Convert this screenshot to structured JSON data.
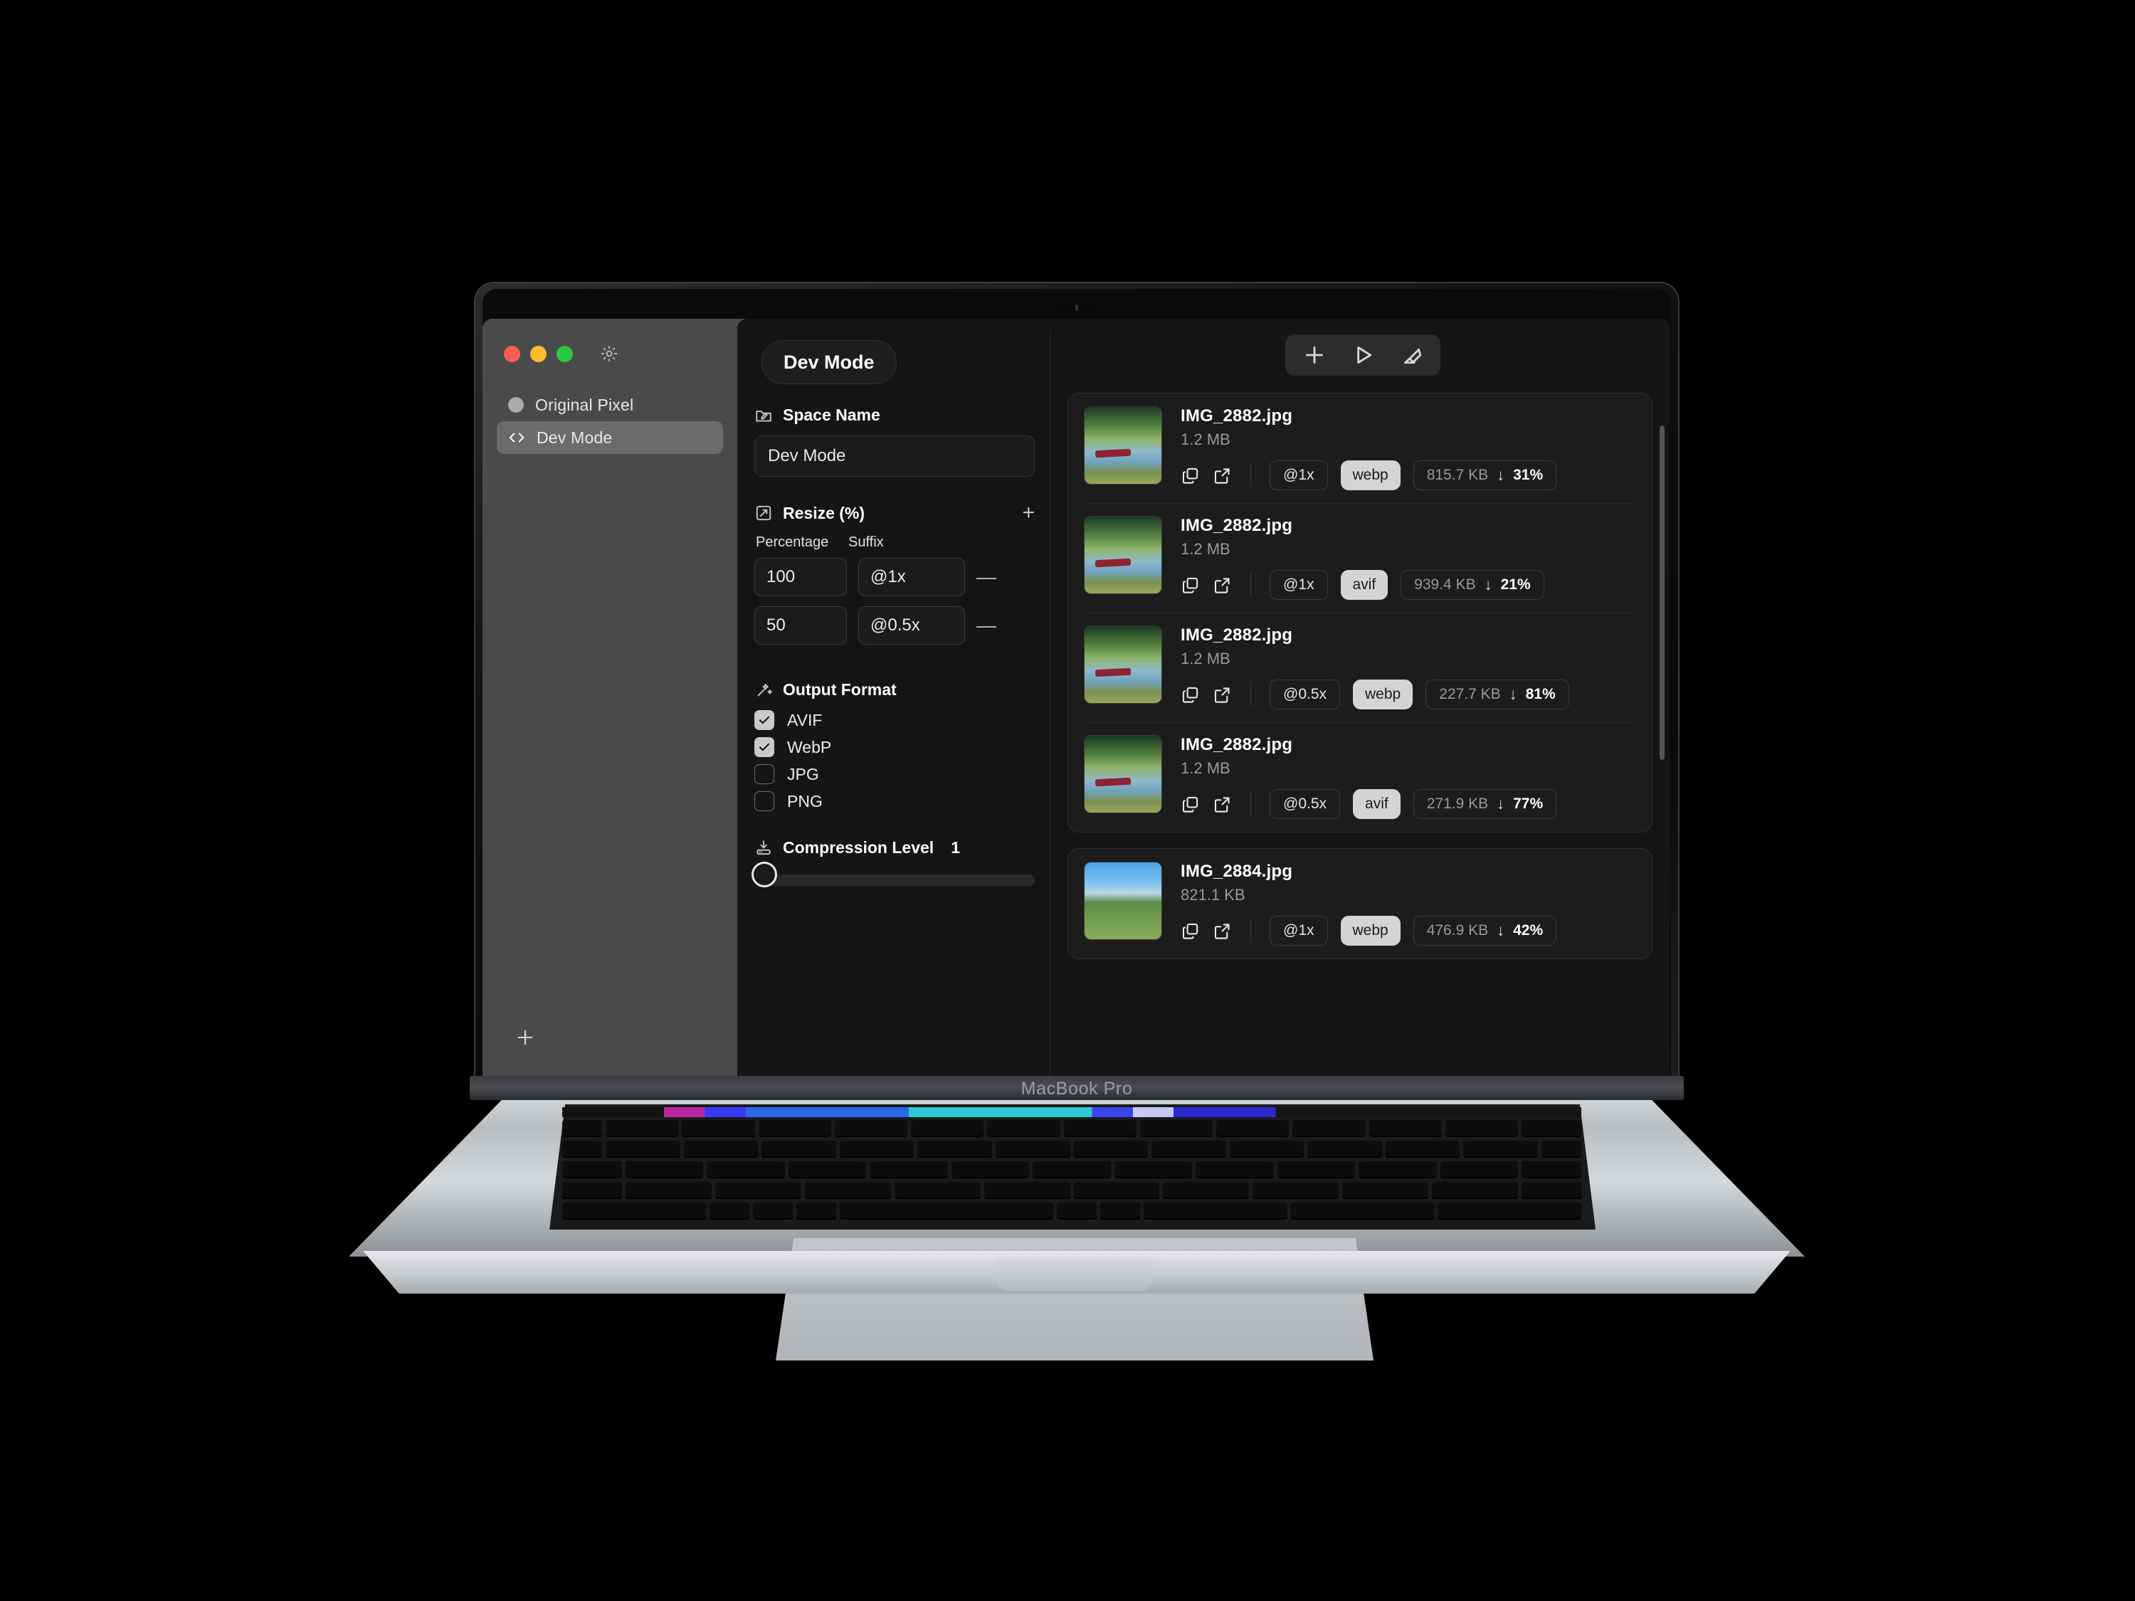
{
  "device": {
    "label": "MacBook Pro"
  },
  "window": {
    "traffic_lights": [
      "close",
      "minimize",
      "zoom"
    ],
    "gear_icon": "gear-icon"
  },
  "sidebar": {
    "items": [
      {
        "label": "Original Pixel",
        "icon": "dot-icon",
        "selected": false
      },
      {
        "label": "Dev Mode",
        "icon": "code-brackets-icon",
        "selected": true
      }
    ],
    "add_label": "+"
  },
  "settings": {
    "mode_pill": "Dev Mode",
    "space_name": {
      "title": "Space Name",
      "icon": "folder-pencil-icon",
      "value": "Dev Mode"
    },
    "resize": {
      "title": "Resize (%)",
      "icon": "resize-arrow-icon",
      "add_label": "+",
      "columns": {
        "percentage": "Percentage",
        "suffix": "Suffix"
      },
      "rows": [
        {
          "percentage": "100",
          "suffix": "@1x",
          "remove_label": "—"
        },
        {
          "percentage": "50",
          "suffix": "@0.5x",
          "remove_label": "—"
        }
      ]
    },
    "output_format": {
      "title": "Output Format",
      "icon": "wand-icon",
      "options": [
        {
          "label": "AVIF",
          "checked": true
        },
        {
          "label": "WebP",
          "checked": true
        },
        {
          "label": "JPG",
          "checked": false
        },
        {
          "label": "PNG",
          "checked": false
        }
      ]
    },
    "compression": {
      "title": "Compression Level",
      "icon": "download-bar-icon",
      "value": "1"
    }
  },
  "toolbar": {
    "buttons": [
      {
        "name": "add-files-button",
        "icon": "plus-icon"
      },
      {
        "name": "run-button",
        "icon": "play-icon"
      },
      {
        "name": "clear-button",
        "icon": "eraser-icon"
      }
    ]
  },
  "file_list": {
    "cards": [
      {
        "rows": [
          {
            "name": "IMG_2882.jpg",
            "size": "1.2 MB",
            "scale": "@1x",
            "format": "webp",
            "out_size": "815.7 KB",
            "arrow": "↓",
            "saving": "31%",
            "thumb": "willow-lake"
          },
          {
            "name": "IMG_2882.jpg",
            "size": "1.2 MB",
            "scale": "@1x",
            "format": "avif",
            "out_size": "939.4 KB",
            "arrow": "↓",
            "saving": "21%",
            "thumb": "willow-lake"
          },
          {
            "name": "IMG_2882.jpg",
            "size": "1.2 MB",
            "scale": "@0.5x",
            "format": "webp",
            "out_size": "227.7 KB",
            "arrow": "↓",
            "saving": "81%",
            "thumb": "willow-lake"
          },
          {
            "name": "IMG_2882.jpg",
            "size": "1.2 MB",
            "scale": "@0.5x",
            "format": "avif",
            "out_size": "271.9 KB",
            "arrow": "↓",
            "saving": "77%",
            "thumb": "willow-lake"
          }
        ]
      },
      {
        "rows": [
          {
            "name": "IMG_2884.jpg",
            "size": "821.1 KB",
            "scale": "@1x",
            "format": "webp",
            "out_size": "476.9 KB",
            "arrow": "↓",
            "saving": "42%",
            "thumb": "blue-sky-park"
          }
        ]
      }
    ],
    "row_actions": [
      {
        "name": "copy-icon"
      },
      {
        "name": "open-external-icon"
      }
    ]
  },
  "colors": {
    "accent_selected": "#6b6b6b",
    "panel_bg": "#151515",
    "card_bg": "#1c1c1c",
    "chip_active_bg": "#d4d4d4",
    "traffic_red": "#fc5f57",
    "traffic_yellow": "#fdbc2e",
    "traffic_green": "#28c840"
  }
}
